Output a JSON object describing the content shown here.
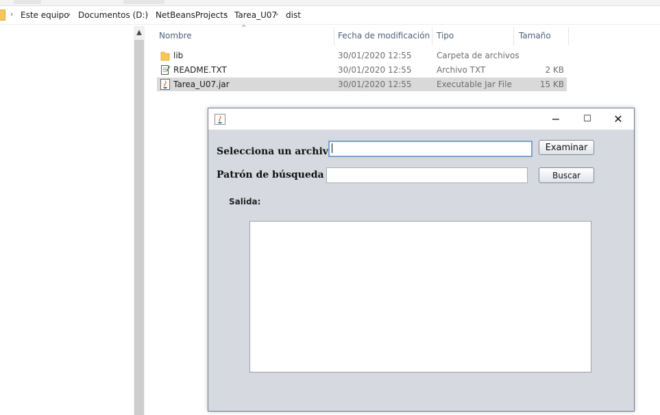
{
  "breadcrumb": {
    "items": [
      "Este equipo",
      "Documentos (D:)",
      "NetBeansProjects",
      "Tarea_U07",
      "dist"
    ],
    "separator": "›"
  },
  "filelist": {
    "sort_indicator": "^",
    "columns": [
      "Nombre",
      "Fecha de modificación",
      "Tipo",
      "Tamaño"
    ],
    "rows": [
      {
        "name": "lib",
        "date": "30/01/2020 12:55",
        "type": "Carpeta de archivos",
        "size": "",
        "icon": "folder-icon"
      },
      {
        "name": "README.TXT",
        "date": "30/01/2020 12:55",
        "type": "Archivo TXT",
        "size": "2 KB",
        "icon": "text-file-icon"
      },
      {
        "name": "Tarea_U07.jar",
        "date": "30/01/2020 12:55",
        "type": "Executable Jar File",
        "size": "15 KB",
        "icon": "jar-file-icon",
        "selected": true
      }
    ]
  },
  "app": {
    "title": "",
    "controls": {
      "minimize": "−",
      "maximize": "☐",
      "close": "✕"
    },
    "select_file_label": "Selecciona un archivo",
    "select_file_value": "",
    "browse_button": "Examinar",
    "pattern_label": "Patrón de búsqueda",
    "pattern_value": "",
    "search_button": "Buscar",
    "output_label": "Salida:",
    "output_text": ""
  },
  "colors": {
    "window_bg": "#d6d9df",
    "selected_row": "#d9d9d9",
    "header_text": "#4c607a",
    "folder": "#f6c659"
  }
}
